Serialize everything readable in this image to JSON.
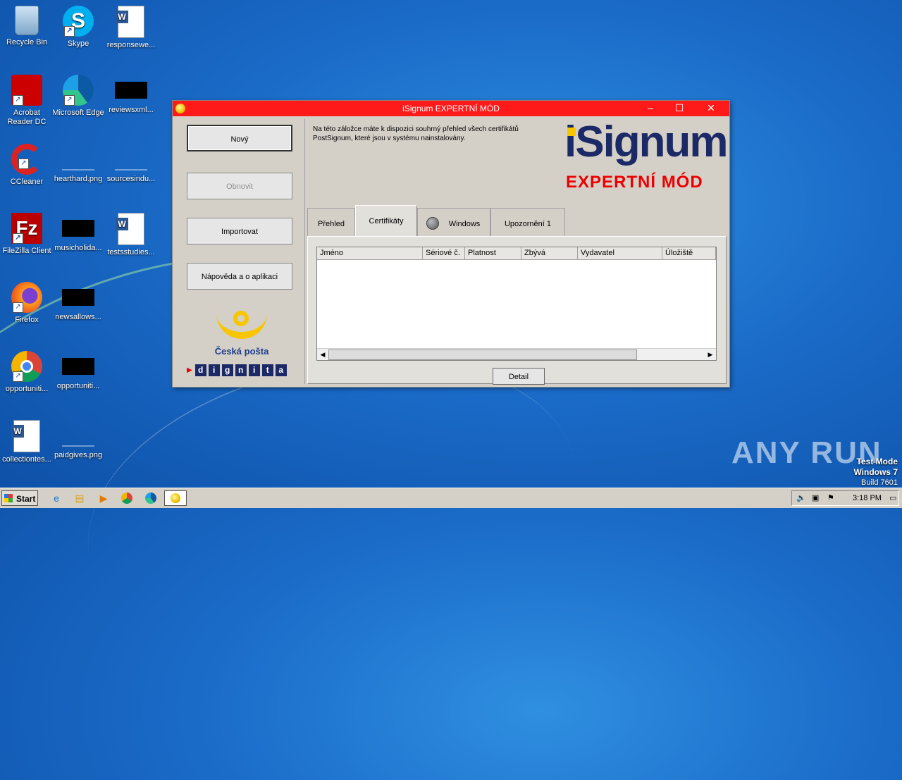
{
  "desktop": {
    "icons": [
      {
        "label": "Recycle Bin"
      },
      {
        "label": "Skype"
      },
      {
        "label": "responsewe..."
      },
      {
        "label": "Acrobat Reader DC"
      },
      {
        "label": "Microsoft Edge"
      },
      {
        "label": "reviewsxml..."
      },
      {
        "label": "CCleaner"
      },
      {
        "label": "hearthard.png"
      },
      {
        "label": "sourcesindu..."
      },
      {
        "label": "FileZilla Client"
      },
      {
        "label": "musicholida..."
      },
      {
        "label": "testsstudies..."
      },
      {
        "label": "Firefox"
      },
      {
        "label": "newsallows..."
      },
      {
        "label": "Google Chrome"
      },
      {
        "label": "opportuniti..."
      },
      {
        "label": "collectiontes..."
      },
      {
        "label": "paidgives.png"
      }
    ],
    "watermark": "ANY RUN",
    "test_mode": {
      "line1": "Test Mode",
      "line2": "Windows 7",
      "line3": "Build 7601"
    }
  },
  "window": {
    "title": "iSignum EXPERTNÍ MÓD",
    "buttons": {
      "new": "Nový",
      "refresh": "Obnovit",
      "import": "Importovat",
      "help": "Nápověda a o aplikaci"
    },
    "posta_name": "Česká pošta",
    "dignita_letters": [
      "d",
      "i",
      "g",
      "n",
      "i",
      "t",
      "a"
    ],
    "description": "Na této záložce máte k dispozici souhrný přehled všech certifikátů PostSignum, které jsou v systému nainstalovány.",
    "logo_text": "iSignum",
    "mode_text": "EXPERTNÍ MÓD",
    "tabs": {
      "overview": "Přehled",
      "certificates": "Certifikáty",
      "windows": "Windows",
      "warnings": "Upozornění 1"
    },
    "columns": [
      "Jméno",
      "Sériové č.",
      "Platnost",
      "Zbývá",
      "Vydavatel",
      "Úložiště"
    ],
    "detail_button": "Detail"
  },
  "taskbar": {
    "start_label": "Start",
    "clock": "3:18 PM"
  }
}
